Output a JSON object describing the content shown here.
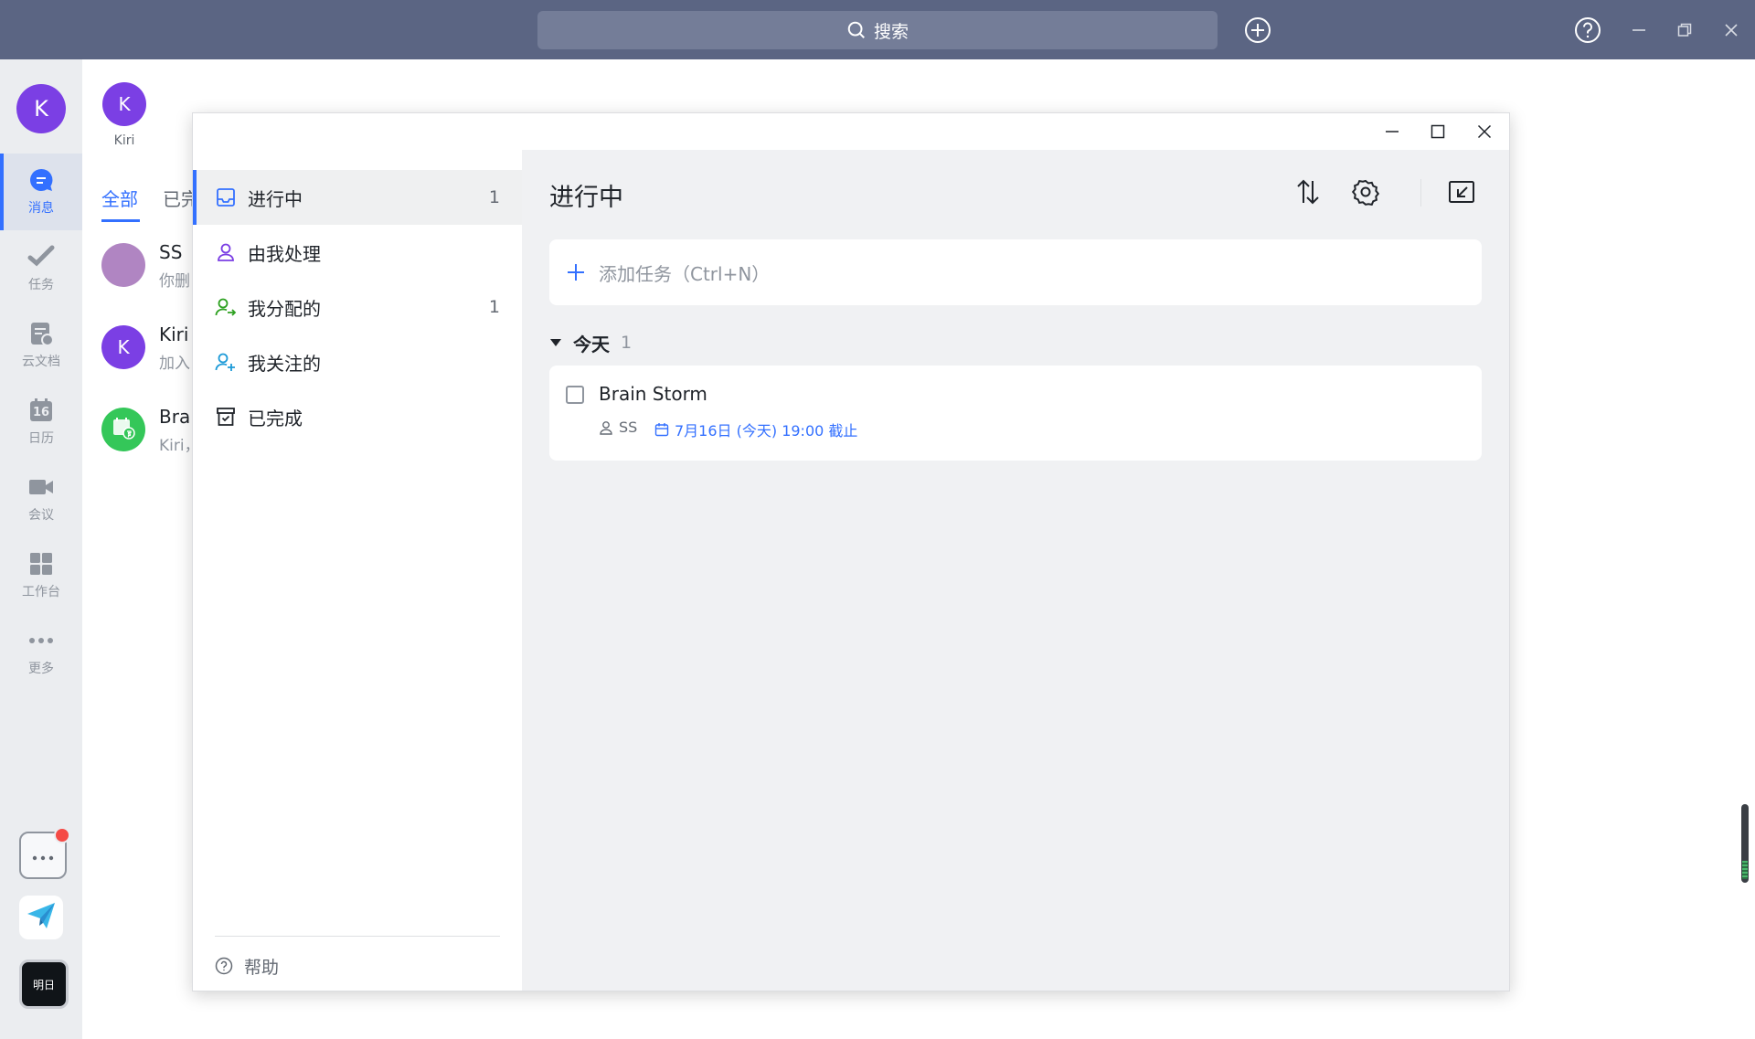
{
  "topbar": {
    "search_label": "搜索"
  },
  "nav": {
    "avatar_letter": "K",
    "items": [
      {
        "label": "消息",
        "icon": "message-icon"
      },
      {
        "label": "任务",
        "icon": "task-icon"
      },
      {
        "label": "云文档",
        "icon": "doc-icon"
      },
      {
        "label": "日历",
        "icon": "calendar-icon",
        "day": "16"
      },
      {
        "label": "会议",
        "icon": "video-icon"
      },
      {
        "label": "工作台",
        "icon": "grid-icon"
      },
      {
        "label": "更多",
        "icon": "more-icon"
      }
    ],
    "bottom_app_label": "明日"
  },
  "chat": {
    "profile": {
      "letter": "K",
      "name": "Kiri"
    },
    "tabs": [
      "全部",
      "已完"
    ],
    "items": [
      {
        "name": "SS",
        "preview": "你删",
        "color": "#b085c2"
      },
      {
        "name": "Kiri",
        "preview": "加入",
        "letter": "K",
        "color": "#7b3fe4"
      },
      {
        "name": "Brai",
        "preview": "Kiri，",
        "color": "#34c759"
      }
    ]
  },
  "task_window": {
    "sidebar": {
      "items": [
        {
          "label": "进行中",
          "count": "1",
          "icon": "inbox-icon",
          "icon_color": "#3370ff"
        },
        {
          "label": "由我处理",
          "count": "",
          "icon": "person-icon",
          "icon_color": "#7b3fe4"
        },
        {
          "label": "我分配的",
          "count": "1",
          "icon": "person-assign-icon",
          "icon_color": "#2ea121"
        },
        {
          "label": "我关注的",
          "count": "",
          "icon": "person-follow-icon",
          "icon_color": "#1e9bd8"
        },
        {
          "label": "已完成",
          "count": "",
          "icon": "archive-icon",
          "icon_color": "#1f2329"
        }
      ],
      "help_label": "帮助"
    },
    "main": {
      "title": "进行中",
      "add_task_placeholder": "添加任务（Ctrl+N）",
      "group": {
        "label": "今天",
        "count": "1"
      },
      "task": {
        "title": "Brain Storm",
        "assignee": "SS",
        "due": "7月16日 (今天) 19:00 截止"
      }
    }
  },
  "colors": {
    "accent": "#3370ff",
    "topbar": "#5b6583"
  }
}
